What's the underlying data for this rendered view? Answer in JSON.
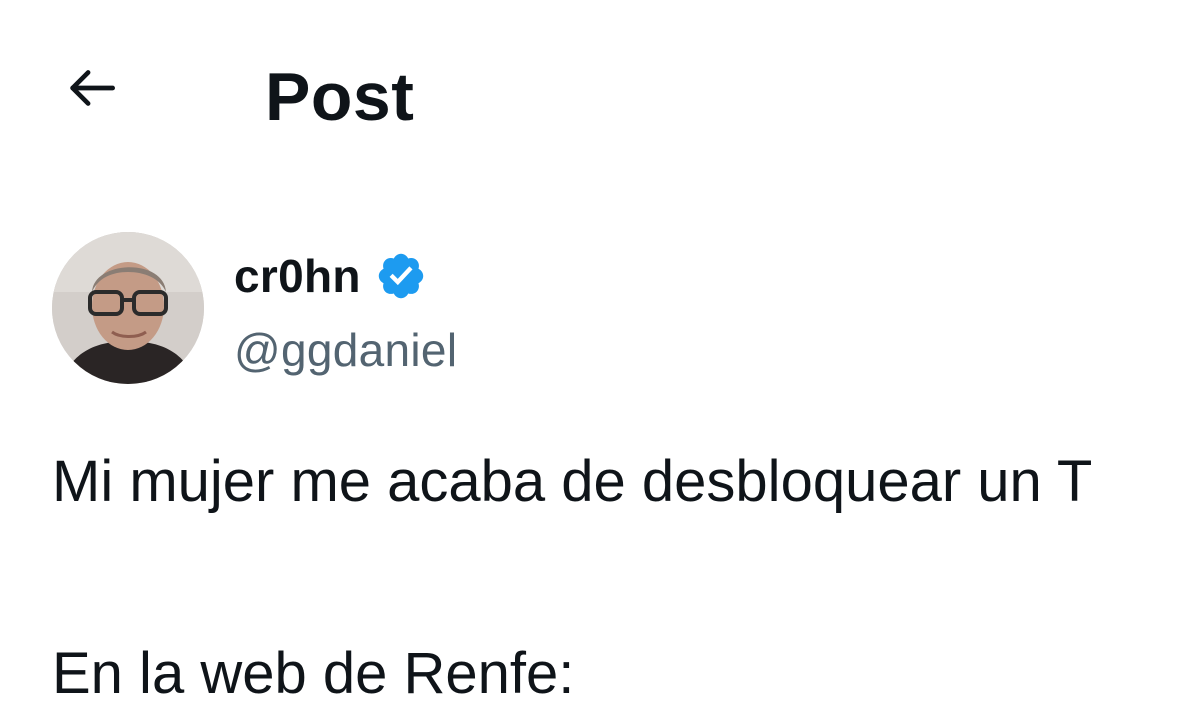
{
  "header": {
    "back_icon": "arrow-left-icon",
    "title": "Post"
  },
  "author": {
    "display_name": "cr0hn",
    "verified_icon": "verified-badge-icon",
    "verified_color": "#1d9bf0",
    "handle": "@ggdaniel"
  },
  "tweet": {
    "lines": [
      "Mi mujer me acaba de desbloquear un T",
      "En la web de Renfe:"
    ]
  },
  "colors": {
    "text": "#0f1419",
    "secondary_text": "#536471",
    "background": "#ffffff"
  }
}
